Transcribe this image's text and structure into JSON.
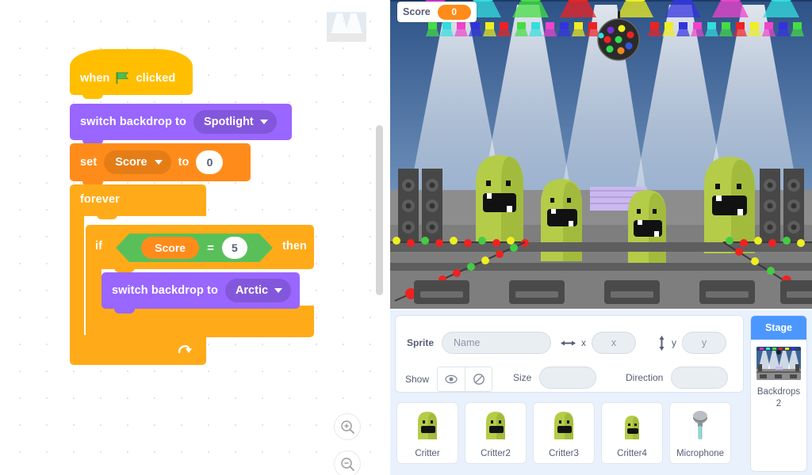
{
  "workspace": {
    "scripts": [
      {
        "block_type": "hat",
        "text_before": "when",
        "icon": "green-flag-icon",
        "text_after": "clicked"
      },
      {
        "block_type": "looks",
        "label": "switch backdrop to",
        "dropdown_value": "Spotlight"
      },
      {
        "block_type": "variables",
        "label": "set",
        "variable": "Score",
        "connector": "to",
        "value": "0"
      },
      {
        "block_type": "control",
        "label": "forever",
        "loop_icon": "loop-arrow-icon"
      },
      {
        "block_type": "control-if",
        "label": "if",
        "then_label": "then",
        "condition": {
          "left": "Score",
          "operator": "=",
          "right": "5"
        }
      },
      {
        "block_type": "looks",
        "label": "switch backdrop to",
        "dropdown_value": "Arctic"
      }
    ],
    "zoom_in_icon": "zoom-in-icon",
    "zoom_out_icon": "zoom-out-icon"
  },
  "stage": {
    "monitor": {
      "name": "Score",
      "value": "0"
    },
    "backdrop_name": "Spotlight"
  },
  "sprite_info": {
    "sprite_label": "Sprite",
    "name_placeholder": "Name",
    "x_label": "x",
    "x_placeholder": "x",
    "y_label": "y",
    "y_placeholder": "y",
    "show_label": "Show",
    "show_icon": "eye-icon",
    "hide_icon": "eye-crossed-icon",
    "size_label": "Size",
    "size_value": "",
    "direction_label": "Direction",
    "direction_value": "",
    "x_arrow_icon": "arrows-horizontal-icon",
    "y_arrow_icon": "arrows-vertical-icon"
  },
  "sprites": [
    {
      "name": "Critter",
      "icon": "critter-icon"
    },
    {
      "name": "Critter2",
      "icon": "critter-icon"
    },
    {
      "name": "Critter3",
      "icon": "critter-icon"
    },
    {
      "name": "Critter4",
      "icon": "critter-icon"
    },
    {
      "name": "Microphone",
      "icon": "microphone-icon"
    }
  ],
  "stage_selector": {
    "title": "Stage",
    "backdrops_label": "Backdrops",
    "backdrops_count": "2"
  },
  "colors": {
    "looks_purple": "#9966FF",
    "variables_orange": "#FF8C1A",
    "control_orange": "#FFAB19",
    "events_yellow": "#FFBF00",
    "operators_green": "#59C059",
    "scratch_blue": "#4C97FF"
  }
}
